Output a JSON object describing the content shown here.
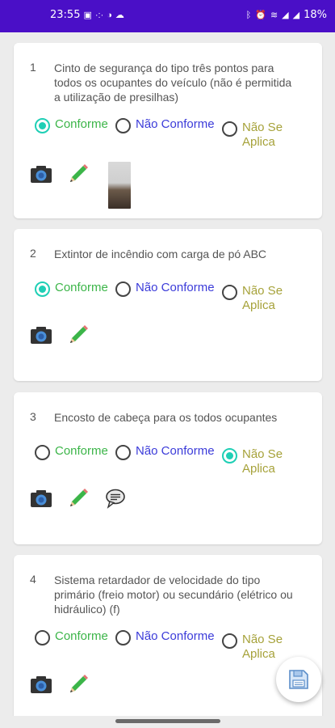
{
  "status_bar": {
    "time": "23:55",
    "battery": "18%",
    "left_icons": [
      "inbox-icon",
      "dots-icon",
      "sync-icon",
      "cloud-icon"
    ],
    "right_icons": [
      "bluetooth-icon",
      "alarm-icon",
      "wifi-icon",
      "signal-icon",
      "signal-icon"
    ]
  },
  "options": {
    "conforme": "Conforme",
    "nao_conforme": "Não Conforme",
    "nao_se_aplica": "Não Se Aplica"
  },
  "colors": {
    "status_bar": "#4a0fc7",
    "selected_radio": "#1fcfb5",
    "conforme": "#3cb549",
    "nao_conforme": "#3b3bd9",
    "nao_se_aplica": "#a6a23a"
  },
  "items": [
    {
      "number": "1",
      "text": "Cinto de segurança do tipo três pontos para todos os ocupantes do veículo (não é permitida a utilização de presilhas)",
      "selected": "conforme",
      "has_photo": true,
      "has_comment": false
    },
    {
      "number": "2",
      "text": "Extintor de incêndio com carga de pó ABC",
      "selected": "conforme",
      "has_photo": false,
      "has_comment": false
    },
    {
      "number": "3",
      "text": "Encosto de cabeça para os todos ocupantes",
      "selected": "nao_se_aplica",
      "has_photo": false,
      "has_comment": true
    },
    {
      "number": "4",
      "text": "Sistema retardador de velocidade do tipo primário (freio motor) ou secundário (elétrico ou hidráulico) (f)",
      "selected": "none",
      "has_photo": false,
      "has_comment": false
    }
  ],
  "fab": {
    "icon": "save-icon"
  }
}
